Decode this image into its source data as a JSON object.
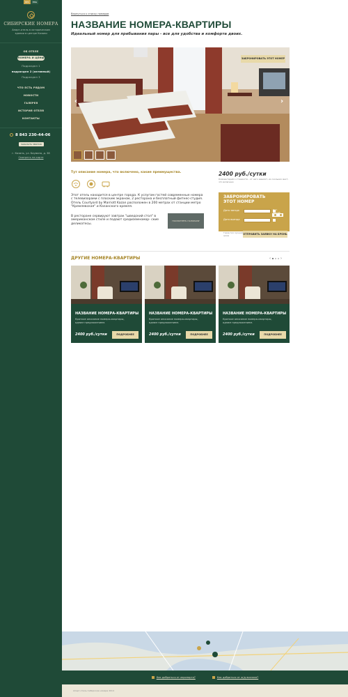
{
  "sidebar": {
    "lang": [
      "РУС",
      "ENG"
    ],
    "brand": "СИБИРСКИЕ НОМЕРА",
    "brand_sub": "Апарт-отель в историческом здании в центре Казани",
    "nav": {
      "about": "ОБ ОТЕЛЕ",
      "rooms": "НОМЕРА И ЦЕНЫ",
      "sub1": "Подраздел 1",
      "sub2": "подраздел 2 (активный)",
      "sub3": "Подраздел 3",
      "nearby": "ЧТО ЕСТЬ РЯДОМ",
      "news": "НОВОСТИ",
      "gallery": "ГАЛЕРЕЯ",
      "history": "ИСТОРИЯ ОТЕЛЯ",
      "contacts": "КОНТАКТЫ"
    },
    "phone": "8 843 230-44-06",
    "call_btn": "ЗАКАЗАТЬ ЗВОНОК",
    "address": "г. Казань, ул. Баумана, д. 38",
    "map_link": "Смотреть на карте"
  },
  "main": {
    "back_link": "Вернуться к списку номеров",
    "title": "НАЗВАНИЕ НОМЕРА-КВАРТИРЫ",
    "tagline": "Идеальный номер для пребывания пары - все для удобства и комфорта двоих.",
    "photo_book_btn": "ЗАБРОНИРОВАТЬ ЭТОТ НОМЕР",
    "desc_head": "Тут описание номера, что включено, какие преимущества.",
    "text1": "Этот отель находится в центре города. К услугам гостей современные номера с телевизорами с плоским экраном, 2 ресторана и бесплатный фитнес-студия. Отель Courtyard by Marriott Kazan расположен в 200 метрах от станции метро \"Кремлевская\" и Казанского кремля.",
    "text2": "В ресторане сервируют завтрак \"шведский стол\" в американском стиле и подают средиземномор- ские деликатесы.",
    "promo_label": "ПОСМОТРЕТЬ ПАНОРАМУ",
    "price": "2400 руб./сутки",
    "price_note": "Комментарий о стоимости - от чего зависит, из скольких мест, что включено",
    "booking": {
      "title": "ЗАБРОНИРОВАТЬ ЭТОТ НОМЕР",
      "checkin_label": "Дата заезда",
      "checkout_label": "Дата выезда",
      "guests_label": "Кол. гостей",
      "note": "Гарантия лучшей цены",
      "send_btn": "ОТПРАВИТЬ ЗАЯВКУ НА БРОНЬ"
    }
  },
  "others": {
    "heading": "ДРУГИЕ НОМЕРА-КВАРТИРЫ",
    "cards": [
      {
        "title": "НАЗВАНИЕ НОМЕРА-КВАРТИРЫ",
        "desc": "Краткое описание номера-квартиры, одним предложением.",
        "price": "2400 руб./сутки",
        "btn": "ПОДРОБНЕЕ"
      },
      {
        "title": "НАЗВАНИЕ НОМЕРА-КВАРТИРЫ",
        "desc": "Краткое описание номера-квартиры, одним предложением.",
        "price": "2400 руб./сутки",
        "btn": "ПОДРОБНЕЕ"
      },
      {
        "title": "НАЗВАНИЕ НОМЕРА-КВАРТИРЫ",
        "desc": "Краткое описание номера-квартиры, одним предложением.",
        "price": "2400 руб./сутки",
        "btn": "ПОДРОБНЕЕ"
      }
    ]
  },
  "how": {
    "airport": "Как добраться от аэропорта?",
    "station": "Как добраться от ж/д вокзала?"
  },
  "footer": "Апарт-отель Сибирские номера 2014",
  "colors": {
    "green": "#1f4a37",
    "gold": "#c9a44a",
    "cream": "#e8d9a9"
  }
}
